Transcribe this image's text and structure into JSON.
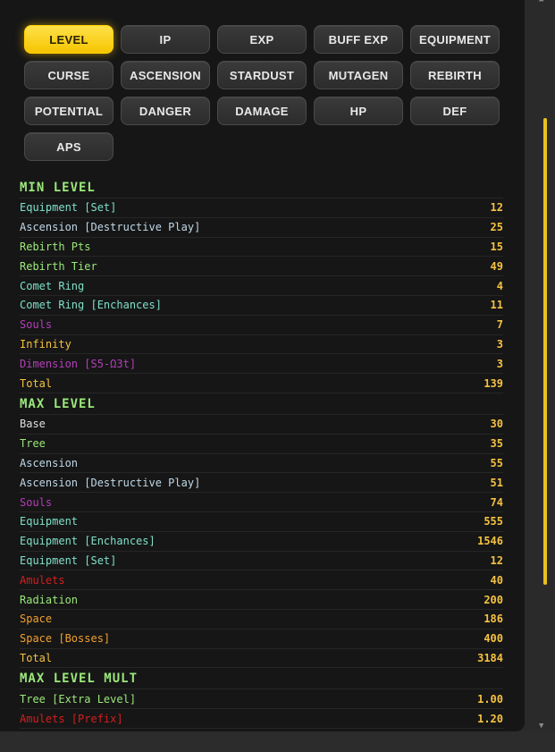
{
  "tabs": [
    {
      "label": "LEVEL",
      "active": true
    },
    {
      "label": "IP"
    },
    {
      "label": "EXP"
    },
    {
      "label": "BUFF EXP"
    },
    {
      "label": "EQUIPMENT"
    },
    {
      "label": "CURSE"
    },
    {
      "label": "ASCENSION"
    },
    {
      "label": "STARDUST"
    },
    {
      "label": "MUTAGEN"
    },
    {
      "label": "REBIRTH"
    },
    {
      "label": "POTENTIAL"
    },
    {
      "label": "DANGER"
    },
    {
      "label": "DAMAGE"
    },
    {
      "label": "HP"
    },
    {
      "label": "DEF"
    },
    {
      "label": "APS"
    }
  ],
  "sections": [
    {
      "title": "MIN LEVEL",
      "rows": [
        {
          "label": "Equipment [Set]",
          "value": "12",
          "color": "#7fe0c8"
        },
        {
          "label": "Ascension [Destructive Play]",
          "value": "25",
          "color": "#c0d8e8"
        },
        {
          "label": "Rebirth Pts",
          "value": "15",
          "color": "#9be87a"
        },
        {
          "label": "Rebirth Tier",
          "value": "49",
          "color": "#9be87a"
        },
        {
          "label": "Comet Ring",
          "value": "4",
          "color": "#7fe0c8"
        },
        {
          "label": "Comet Ring [Enchances]",
          "value": "11",
          "color": "#7fe0c8"
        },
        {
          "label": "Souls",
          "value": "7",
          "color": "#b23fb8"
        },
        {
          "label": "Infinity",
          "value": "3",
          "color": "#f5c242"
        },
        {
          "label": "Dimension [S5-Ω3t]",
          "value": "3",
          "color": "#b23fb8"
        },
        {
          "label": "Total",
          "value": "139",
          "color": "#f5c242"
        }
      ]
    },
    {
      "title": "MAX LEVEL",
      "rows": [
        {
          "label": "Base",
          "value": "30",
          "color": "#e0e0e0"
        },
        {
          "label": "Tree",
          "value": "35",
          "color": "#9be87a"
        },
        {
          "label": "Ascension",
          "value": "55",
          "color": "#c0d8e8"
        },
        {
          "label": "Ascension [Destructive Play]",
          "value": "51",
          "color": "#c0d8e8"
        },
        {
          "label": "Souls",
          "value": "74",
          "color": "#b23fb8"
        },
        {
          "label": "Equipment",
          "value": "555",
          "color": "#7fe0c8"
        },
        {
          "label": "Equipment [Enchances]",
          "value": "1546",
          "color": "#7fe0c8"
        },
        {
          "label": "Equipment [Set]",
          "value": "12",
          "color": "#7fe0c8"
        },
        {
          "label": "Amulets",
          "value": "40",
          "color": "#d21f1f"
        },
        {
          "label": "Radiation",
          "value": "200",
          "color": "#9be87a"
        },
        {
          "label": "Space",
          "value": "186",
          "color": "#f0a030"
        },
        {
          "label": "Space [Bosses]",
          "value": "400",
          "color": "#f0a030"
        },
        {
          "label": "Total",
          "value": "3184",
          "color": "#f5c242"
        }
      ]
    },
    {
      "title": "MAX LEVEL MULT",
      "rows": [
        {
          "label": "Tree [Extra Level]",
          "value": "1.00",
          "color": "#9be87a"
        },
        {
          "label": "Amulets [Prefix]",
          "value": "1.20",
          "color": "#d21f1f"
        }
      ]
    }
  ],
  "scrollbar": {
    "thumb_color": "#e8c11f"
  }
}
